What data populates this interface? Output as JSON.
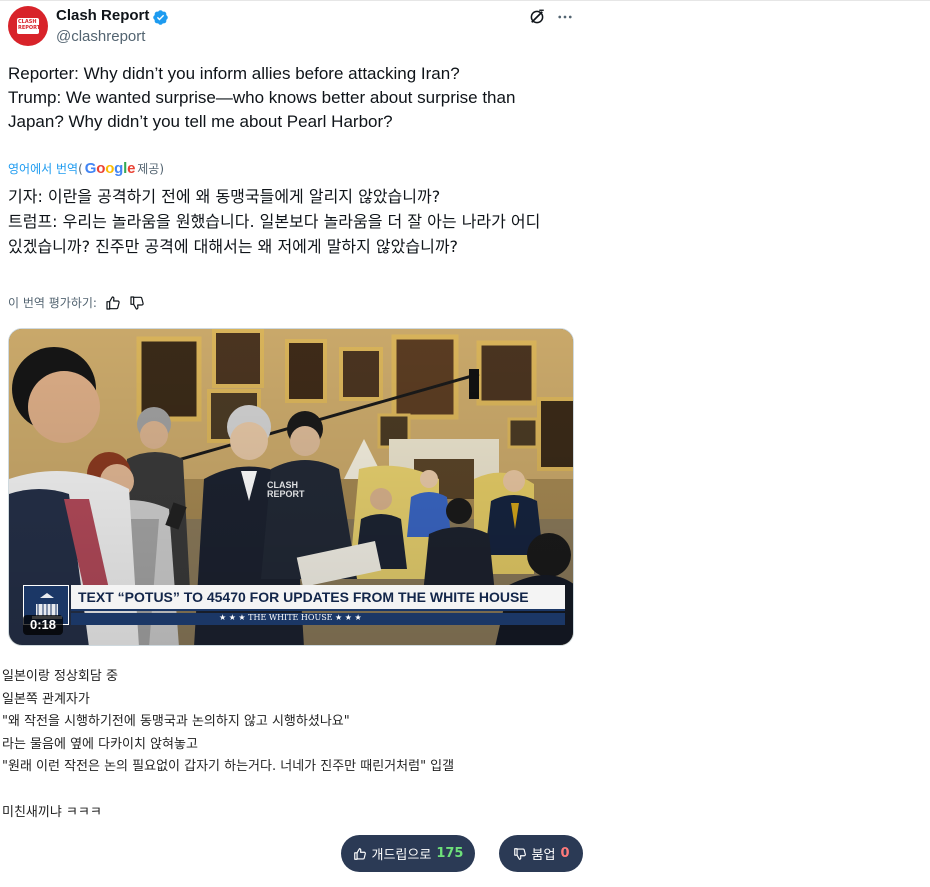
{
  "tweet": {
    "avatar_text": "CLASH REPORT",
    "display_name": "Clash Report",
    "handle": "@clashreport",
    "body_lines": [
      "Reporter: Why didn’t you inform allies before attacking Iran?",
      "",
      "Trump: We wanted surprise—who knows better about surprise than",
      "Japan? Why didn’t you tell me about Pearl Harbor?"
    ],
    "translated_from": "영어에서 번역",
    "translated_by_prefix": "(",
    "translated_by_logo": "Google",
    "translated_by_suffix": " 제공)",
    "translation_lines": [
      "기자: 이란을 공격하기 전에 왜 동맹국들에게 알리지 않았습니까?",
      "",
      "트럼프: 우리는 놀라움을 원했습니다. 일본보다 놀라움을 더 잘 아는 나라가 어디",
      "있겠습니까? 진주만 공격에 대해서는 왜 저에게 말하지 않았습니까?"
    ],
    "rate_translation": "이 번역 평가하기:",
    "media": {
      "banner_text": "TEXT “POTUS” TO 45470 FOR UPDATES FROM THE WHITE HOUSE",
      "banner_sub": "★ ★ ★   THE WHITE HOUSE   ★ ★ ★",
      "watermark": "CLASH REPORT",
      "duration": "0:18"
    }
  },
  "comment": {
    "lines": [
      "일본이랑 정상회담 중",
      "일본쪽 관계자가",
      "\"왜 작전을 시행하기전에 동맹국과 논의하지 않고 시행하셨나요\"",
      "라는 물음에 옆에 다카이치 앉혀놓고",
      "\"원래 이런 작전은 논의 필요없이 갑자기 하는거다. 너네가 진주만 때린거처럼\" 입갤",
      "",
      "미친새끼냐 ㅋㅋㅋ"
    ]
  },
  "votes": {
    "up_label": "개드립으로",
    "up_count": "175",
    "down_label": "붐업",
    "down_count": "0"
  },
  "colors": {
    "link": "#1d9bf0",
    "button_bg": "#2b3a55",
    "up_count": "#6ee07a",
    "down_count": "#ff7a7a",
    "brand_red": "#d8232a"
  }
}
